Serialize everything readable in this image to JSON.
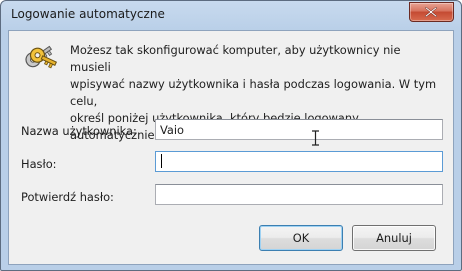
{
  "window": {
    "title": "Logowanie automatyczne"
  },
  "icons": {
    "app": "keys-icon",
    "close": "close-icon",
    "cursor": "text-cursor-icon"
  },
  "description": "Możesz tak skonfigurować komputer, aby użytkownicy nie musieli\nwpisywać nazwy użytkownika i hasła podczas logowania. W tym celu,\nokreśl poniżej użytkownika, który będzie logowany automatycznie:",
  "form": {
    "username": {
      "label": "Nazwa użytkownika:",
      "value": "Vaio"
    },
    "password": {
      "label": "Hasło:",
      "value": ""
    },
    "confirm_password": {
      "label": "Potwierdź hasło:",
      "value": ""
    }
  },
  "buttons": {
    "ok": "OK",
    "cancel": "Anuluj"
  },
  "colors": {
    "title_bar": "#b9cfe8",
    "close_button": "#c44a32",
    "dialog_background": "#f0f0f0",
    "focus_border": "#5b9bd5"
  }
}
